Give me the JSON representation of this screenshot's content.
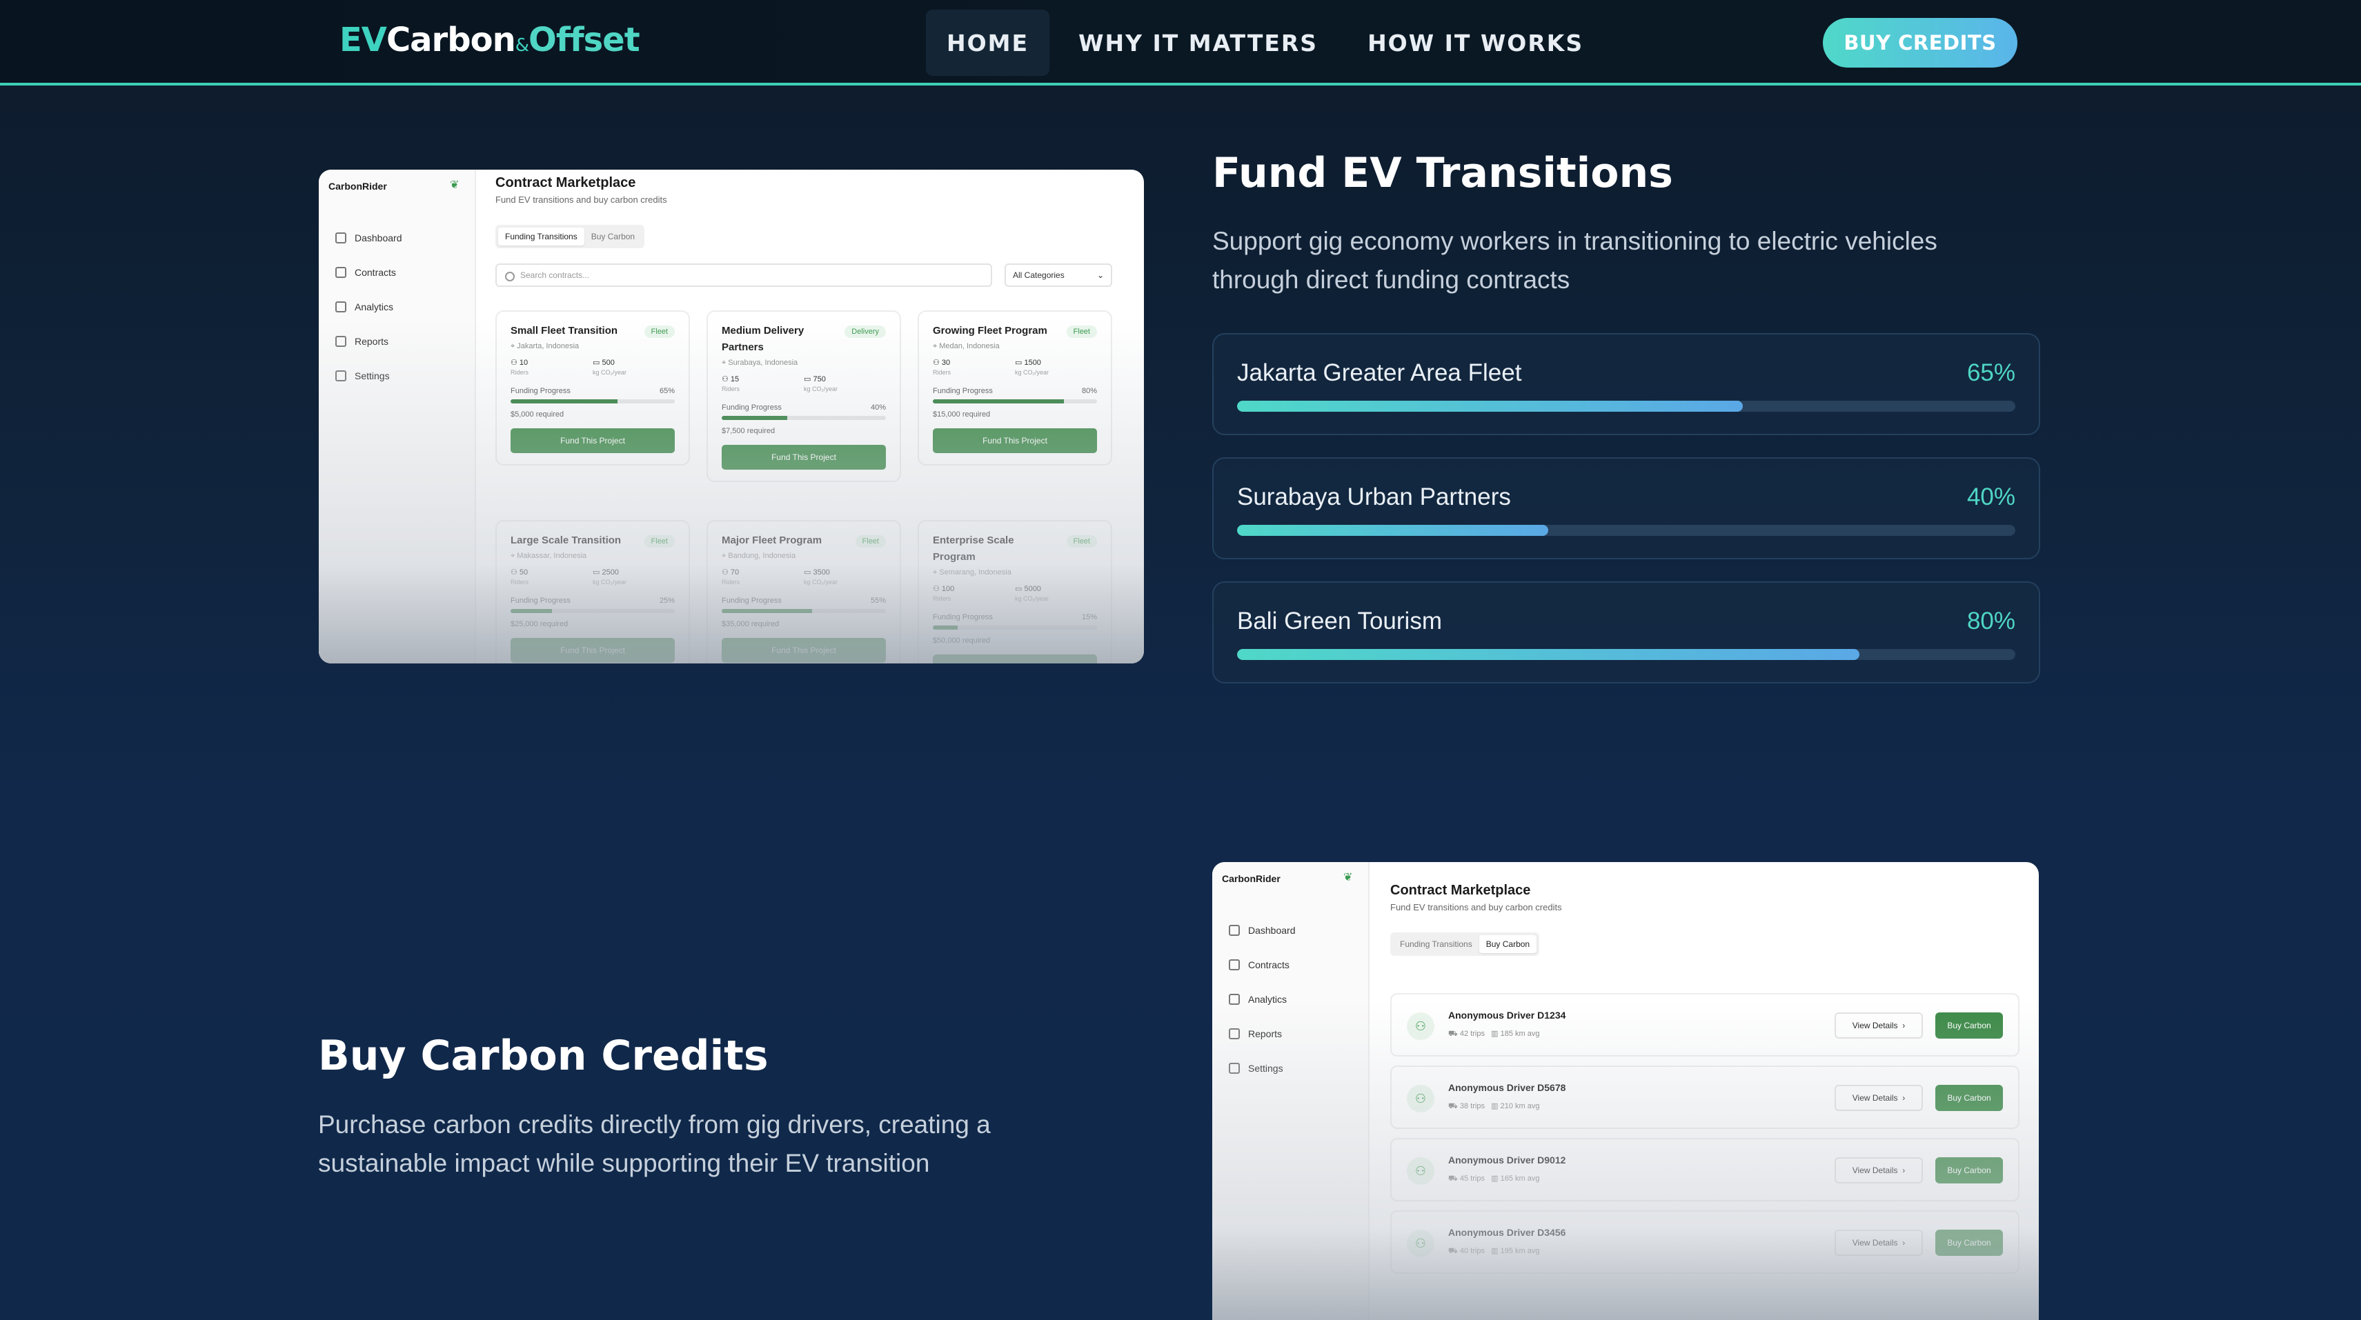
{
  "nav": {
    "logo_ev": "EV",
    "logo_carbon": "Carbon",
    "logo_amp": "&",
    "logo_offset": "Offset",
    "links": [
      "HOME",
      "WHY IT MATTERS",
      "HOW IT WORKS"
    ],
    "active_link": "HOME",
    "cta": "BUY CREDITS"
  },
  "fund_section": {
    "title": "Fund EV Transitions",
    "description": "Support gig economy workers in transitioning to electric vehicles through direct funding contracts",
    "projects": [
      {
        "name": "Jakarta Greater Area Fleet",
        "percent_label": "65%",
        "progress": 65
      },
      {
        "name": "Surabaya Urban Partners",
        "percent_label": "40%",
        "progress": 40
      },
      {
        "name": "Bali Green Tourism",
        "percent_label": "80%",
        "progress": 80
      }
    ]
  },
  "buy_section": {
    "title": "Buy Carbon Credits",
    "description": "Purchase carbon credits directly from gig drivers, creating a sustainable impact while supporting their EV transition"
  },
  "mock_app": {
    "brand": "CarbonRider",
    "sidebar": [
      "Dashboard",
      "Contracts",
      "Analytics",
      "Reports",
      "Settings"
    ],
    "title": "Contract Marketplace",
    "subtitle": "Fund EV transitions and buy carbon credits",
    "tabs": [
      "Funding Transitions",
      "Buy Carbon"
    ],
    "search_placeholder": "Search contracts...",
    "category_select": "All Categories",
    "riders_label": "Riders",
    "co2_label": "kg CO₂/year",
    "funding_progress_label": "Funding Progress",
    "fund_button": "Fund This Project",
    "cards": [
      {
        "name": "Small Fleet Transition",
        "tag": "Fleet",
        "location": "Jakarta, Indonesia",
        "riders": "10",
        "co2": "500",
        "percent_label": "65%",
        "progress": 65,
        "required": "$5,000 required"
      },
      {
        "name": "Medium Delivery Partners",
        "tag": "Delivery",
        "location": "Surabaya, Indonesia",
        "riders": "15",
        "co2": "750",
        "percent_label": "40%",
        "progress": 40,
        "required": "$7,500 required"
      },
      {
        "name": "Growing Fleet Program",
        "tag": "Fleet",
        "location": "Medan, Indonesia",
        "riders": "30",
        "co2": "1500",
        "percent_label": "80%",
        "progress": 80,
        "required": "$15,000 required"
      },
      {
        "name": "Large Scale Transition",
        "tag": "Fleet",
        "location": "Makassar, Indonesia",
        "riders": "50",
        "co2": "2500",
        "percent_label": "25%",
        "progress": 25,
        "required": "$25,000 required"
      },
      {
        "name": "Major Fleet Program",
        "tag": "Fleet",
        "location": "Bandung, Indonesia",
        "riders": "70",
        "co2": "3500",
        "percent_label": "55%",
        "progress": 55,
        "required": "$35,000 required"
      },
      {
        "name": "Enterprise Scale Program",
        "tag": "Fleet",
        "location": "Semarang, Indonesia",
        "riders": "100",
        "co2": "5000",
        "percent_label": "15%",
        "progress": 15,
        "required": "$50,000 required"
      }
    ],
    "view_details": "View Details",
    "buy_carbon": "Buy Carbon",
    "drivers": [
      {
        "name": "Anonymous Driver D1234",
        "trips": "42 trips",
        "avg": "185 km avg"
      },
      {
        "name": "Anonymous Driver D5678",
        "trips": "38 trips",
        "avg": "210 km avg"
      },
      {
        "name": "Anonymous Driver D9012",
        "trips": "45 trips",
        "avg": "165 km avg"
      },
      {
        "name": "Anonymous Driver D3456",
        "trips": "40 trips",
        "avg": "195 km avg"
      }
    ]
  },
  "colors": {
    "accent": "#4fd6c4",
    "accent_blue": "#5ab5ea",
    "mock_green": "#3c8a47"
  }
}
